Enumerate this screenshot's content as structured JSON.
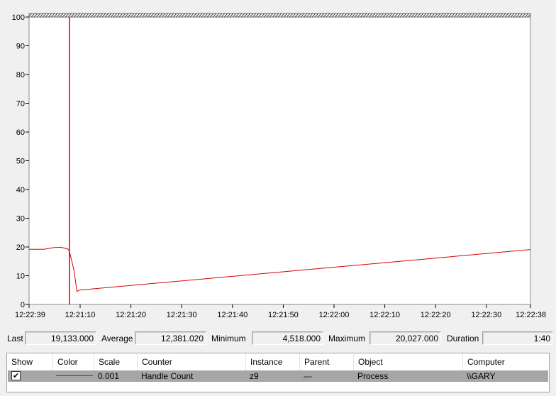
{
  "chart_data": {
    "type": "line",
    "y_ticks": [
      "0",
      "10",
      "20",
      "30",
      "40",
      "50",
      "60",
      "70",
      "80",
      "90",
      "100"
    ],
    "x_ticks": [
      "12:22:39",
      "12:21:10",
      "12:21:20",
      "12:21:30",
      "12:21:40",
      "12:21:50",
      "12:22:00",
      "12:22:10",
      "12:22:20",
      "12:22:30",
      "12:22:38"
    ],
    "ylim": [
      0,
      100
    ],
    "grid": false,
    "series": [
      {
        "color": "#d80000",
        "points": [
          [
            0,
            19.2
          ],
          [
            3,
            19.2
          ],
          [
            5,
            19.8
          ],
          [
            6.3,
            19.9
          ],
          [
            7.7,
            19.3
          ],
          [
            8,
            18.5
          ],
          [
            8.9,
            12
          ],
          [
            9.5,
            4.5
          ],
          [
            10,
            5
          ],
          [
            99.5,
            19.1
          ]
        ],
        "cursor_x": 8.0
      }
    ],
    "x_range": [
      0,
      99.5
    ]
  },
  "stats": {
    "last_label": "Last",
    "last_value": "19,133.000",
    "average_label": "Average",
    "average_value": "12,381.020",
    "minimum_label": "Minimum",
    "minimum_value": "4,518.000",
    "maximum_label": "Maximum",
    "maximum_value": "20,027.000",
    "duration_label": "Duration",
    "duration_value": "1:40"
  },
  "legend": {
    "headers": {
      "show": "Show",
      "color": "Color",
      "scale": "Scale",
      "counter": "Counter",
      "instance": "Instance",
      "parent": "Parent",
      "object": "Object",
      "computer": "Computer"
    },
    "rows": [
      {
        "show_checked": "✔",
        "color": "#e00000",
        "scale": "0.001",
        "counter": "Handle Count",
        "instance": "z9",
        "parent": "---",
        "object": "Process",
        "computer": "\\\\GARY"
      }
    ]
  }
}
